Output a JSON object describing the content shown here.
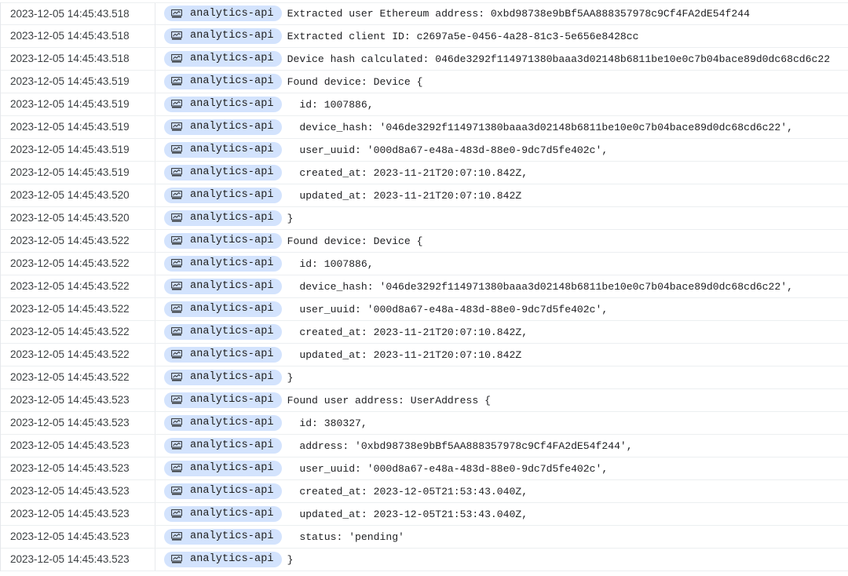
{
  "log": {
    "service_icon": "server-icon",
    "colors": {
      "chip_background": "#d3e3fd",
      "row_border": "#eceff1"
    },
    "rows": [
      {
        "timestamp": "2023-12-05 14:45:43.518",
        "service": "analytics-api",
        "message": "Extracted user Ethereum address: 0xbd98738e9bBf5AA888357978c9Cf4FA2dE54f244"
      },
      {
        "timestamp": "2023-12-05 14:45:43.518",
        "service": "analytics-api",
        "message": "Extracted client ID: c2697a5e-0456-4a28-81c3-5e656e8428cc"
      },
      {
        "timestamp": "2023-12-05 14:45:43.518",
        "service": "analytics-api",
        "message": "Device hash calculated: 046de3292f114971380baaa3d02148b6811be10e0c7b04bace89d0dc68cd6c22"
      },
      {
        "timestamp": "2023-12-05 14:45:43.519",
        "service": "analytics-api",
        "message": "Found device: Device {"
      },
      {
        "timestamp": "2023-12-05 14:45:43.519",
        "service": "analytics-api",
        "message": "  id: 1007886,"
      },
      {
        "timestamp": "2023-12-05 14:45:43.519",
        "service": "analytics-api",
        "message": "  device_hash: '046de3292f114971380baaa3d02148b6811be10e0c7b04bace89d0dc68cd6c22',"
      },
      {
        "timestamp": "2023-12-05 14:45:43.519",
        "service": "analytics-api",
        "message": "  user_uuid: '000d8a67-e48a-483d-88e0-9dc7d5fe402c',"
      },
      {
        "timestamp": "2023-12-05 14:45:43.519",
        "service": "analytics-api",
        "message": "  created_at: 2023-11-21T20:07:10.842Z,"
      },
      {
        "timestamp": "2023-12-05 14:45:43.520",
        "service": "analytics-api",
        "message": "  updated_at: 2023-11-21T20:07:10.842Z"
      },
      {
        "timestamp": "2023-12-05 14:45:43.520",
        "service": "analytics-api",
        "message": "}"
      },
      {
        "timestamp": "2023-12-05 14:45:43.522",
        "service": "analytics-api",
        "message": "Found device: Device {"
      },
      {
        "timestamp": "2023-12-05 14:45:43.522",
        "service": "analytics-api",
        "message": "  id: 1007886,"
      },
      {
        "timestamp": "2023-12-05 14:45:43.522",
        "service": "analytics-api",
        "message": "  device_hash: '046de3292f114971380baaa3d02148b6811be10e0c7b04bace89d0dc68cd6c22',"
      },
      {
        "timestamp": "2023-12-05 14:45:43.522",
        "service": "analytics-api",
        "message": "  user_uuid: '000d8a67-e48a-483d-88e0-9dc7d5fe402c',"
      },
      {
        "timestamp": "2023-12-05 14:45:43.522",
        "service": "analytics-api",
        "message": "  created_at: 2023-11-21T20:07:10.842Z,"
      },
      {
        "timestamp": "2023-12-05 14:45:43.522",
        "service": "analytics-api",
        "message": "  updated_at: 2023-11-21T20:07:10.842Z"
      },
      {
        "timestamp": "2023-12-05 14:45:43.522",
        "service": "analytics-api",
        "message": "}"
      },
      {
        "timestamp": "2023-12-05 14:45:43.523",
        "service": "analytics-api",
        "message": "Found user address: UserAddress {"
      },
      {
        "timestamp": "2023-12-05 14:45:43.523",
        "service": "analytics-api",
        "message": "  id: 380327,"
      },
      {
        "timestamp": "2023-12-05 14:45:43.523",
        "service": "analytics-api",
        "message": "  address: '0xbd98738e9bBf5AA888357978c9Cf4FA2dE54f244',"
      },
      {
        "timestamp": "2023-12-05 14:45:43.523",
        "service": "analytics-api",
        "message": "  user_uuid: '000d8a67-e48a-483d-88e0-9dc7d5fe402c',"
      },
      {
        "timestamp": "2023-12-05 14:45:43.523",
        "service": "analytics-api",
        "message": "  created_at: 2023-12-05T21:53:43.040Z,"
      },
      {
        "timestamp": "2023-12-05 14:45:43.523",
        "service": "analytics-api",
        "message": "  updated_at: 2023-12-05T21:53:43.040Z,"
      },
      {
        "timestamp": "2023-12-05 14:45:43.523",
        "service": "analytics-api",
        "message": "  status: 'pending'"
      },
      {
        "timestamp": "2023-12-05 14:45:43.523",
        "service": "analytics-api",
        "message": "}"
      }
    ]
  }
}
